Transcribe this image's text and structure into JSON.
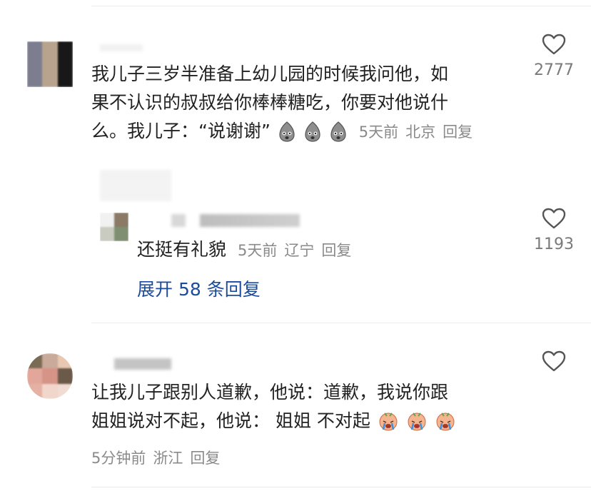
{
  "comments": [
    {
      "text_lines": [
        "我儿子三岁半准备上幼儿园的时候我问他，如",
        "果不认识的叔叔给你棒棒糖吃，你要对他说什",
        "么。我儿子：“说谢谢”"
      ],
      "emoji": "sweat-face-icon",
      "time": "5天前",
      "location": "北京",
      "reply_label": "回复",
      "likes": "2777",
      "reply": {
        "text": "还挺有礼貌",
        "time": "5天前",
        "location": "辽宁",
        "reply_label": "回复",
        "likes": "1193"
      },
      "expand_label": "展开 58 条回复"
    },
    {
      "text_lines": [
        "让我儿子跟别人道歉，他说：道歉，我说你跟",
        "姐姐说对不起，他说：  姐姐 不对起"
      ],
      "emoji": "crying-face-icon",
      "time": "5分钟前",
      "location": "浙江",
      "reply_label": "回复"
    }
  ],
  "colors": {
    "link": "#1b4b9c",
    "meta": "#8a8a8a",
    "divider": "#ececec"
  }
}
